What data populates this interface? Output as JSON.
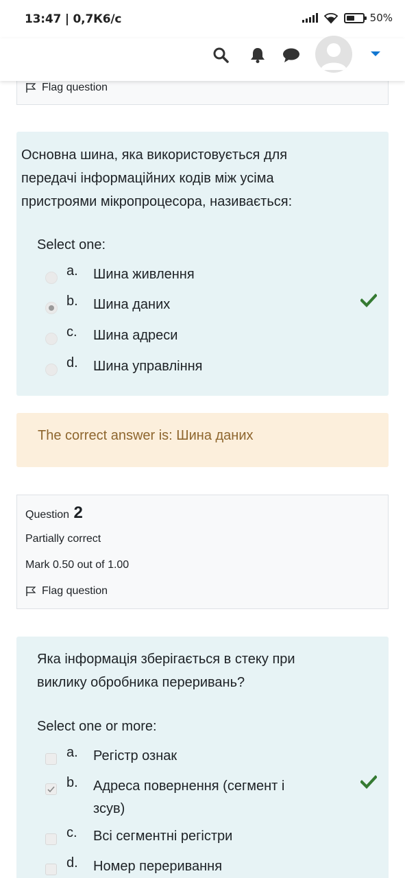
{
  "status_bar": {
    "time": "13:47 | 0,7К6/с",
    "battery": "50%"
  },
  "navbar": {
    "icons": [
      "search-icon",
      "bell-icon",
      "chat-icon",
      "user-avatar-icon",
      "caret-down-icon"
    ]
  },
  "question1_info": {
    "flag_label": "Flag question"
  },
  "question1": {
    "text": "Основна шина, яка використовується для передачі інформаційних кодів між усіма пристроями мікропроцесора, називається:",
    "prompt": "Select one:",
    "options": [
      {
        "letter": "a.",
        "text": "Шина живлення",
        "selected": false,
        "correct": false
      },
      {
        "letter": "b.",
        "text": "Шина даних",
        "selected": true,
        "correct": true
      },
      {
        "letter": "c.",
        "text": "Шина адреси",
        "selected": false,
        "correct": false
      },
      {
        "letter": "d.",
        "text": "Шина управління",
        "selected": false,
        "correct": false
      }
    ],
    "feedback": "The correct answer is: Шина даних"
  },
  "question2_info": {
    "label": "Question",
    "number": "2",
    "state": "Partially correct",
    "mark": "Mark 0.50 out of 1.00",
    "flag_label": "Flag question"
  },
  "question2": {
    "text": "Яка інформація зберігається в стеку при виклику обробника переривань?",
    "prompt": "Select one or more:",
    "options": [
      {
        "letter": "a.",
        "text": "Регістр ознак",
        "selected": false,
        "correct": false
      },
      {
        "letter": "b.",
        "text": "Адреса повернення (сегмент і зсув)",
        "selected": true,
        "correct": true
      },
      {
        "letter": "c.",
        "text": "Всі сегментні регістри",
        "selected": false,
        "correct": false
      },
      {
        "letter": "d.",
        "text": "Номер переривання",
        "selected": false,
        "correct": false
      }
    ]
  },
  "colors": {
    "question_bg": "#e7f3f5",
    "feedback_bg": "#fcefdc",
    "feedback_text": "#8e662e",
    "correct_tick": "#357a32",
    "accent": "#1177d1"
  }
}
